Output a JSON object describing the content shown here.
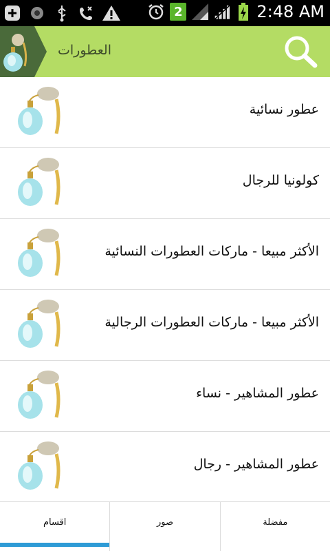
{
  "status_bar": {
    "time": "2:48 AM",
    "notification_count": "2"
  },
  "app_bar": {
    "title": "العطورات"
  },
  "categories": [
    {
      "label": "عطور نسائية"
    },
    {
      "label": "كولونيا للرجال"
    },
    {
      "label": "الأكثر مبيعا - ماركات العطورات النسائية"
    },
    {
      "label": "الأكثر مبيعا - ماركات العطورات الرجالية"
    },
    {
      "label": "عطور المشاهير - نساء"
    },
    {
      "label": "عطور المشاهير - رجال"
    }
  ],
  "tabs": [
    {
      "label": "مفضلة"
    },
    {
      "label": "صور"
    },
    {
      "label": "اقسام"
    }
  ],
  "colors": {
    "app_bar": "#b4dc64",
    "active_tab_indicator": "#2e9bd6"
  }
}
